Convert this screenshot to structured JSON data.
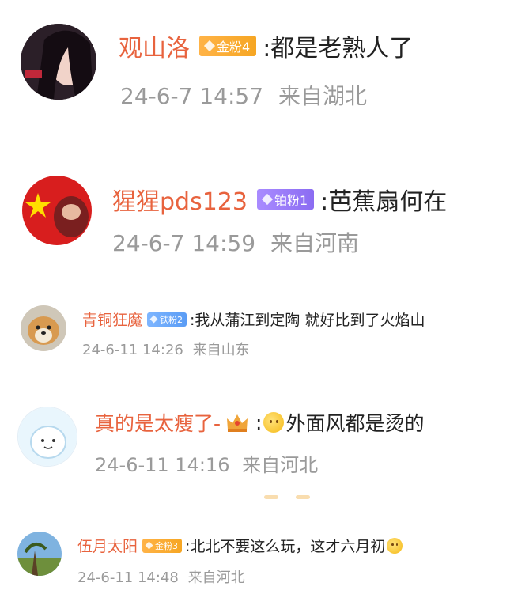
{
  "comments": [
    {
      "user": "观山洛",
      "badge": "金粉4",
      "text": ":都是老熟人了",
      "time": "24-6-7 14:57",
      "location": "来自湖北",
      "badge_color": "#f6a623"
    },
    {
      "user": "猩猩pds123",
      "badge": "铂粉1",
      "text": ":芭蕉扇何在",
      "time": "24-6-7 14:59",
      "location": "来自河南",
      "badge_color": "#8b6cf2"
    },
    {
      "user": "青铜狂魔",
      "badge": "铁粉2",
      "text": ":我从蒲江到定陶 就好比到了火焰山",
      "time": "24-6-11 14:26",
      "location": "来自山东",
      "badge_color": "#5a9cf5"
    },
    {
      "user": "真的是太瘦了-",
      "badge": "",
      "text_prefix": ":",
      "text": "外面风都是烫的",
      "time": "24-6-11 14:16",
      "location": "来自河北",
      "emoji": "crying-laughing"
    },
    {
      "user": "伍月太阳",
      "badge": "金粉3",
      "text": ":北北不要这么玩，这才六月初",
      "time": "24-6-11 14:48",
      "location": "来自河北",
      "badge_color": "#f6a623",
      "emoji": "crying-laughing"
    }
  ],
  "colors": {
    "username": "#e8633e",
    "text": "#222222",
    "meta": "#9a9a9a"
  }
}
